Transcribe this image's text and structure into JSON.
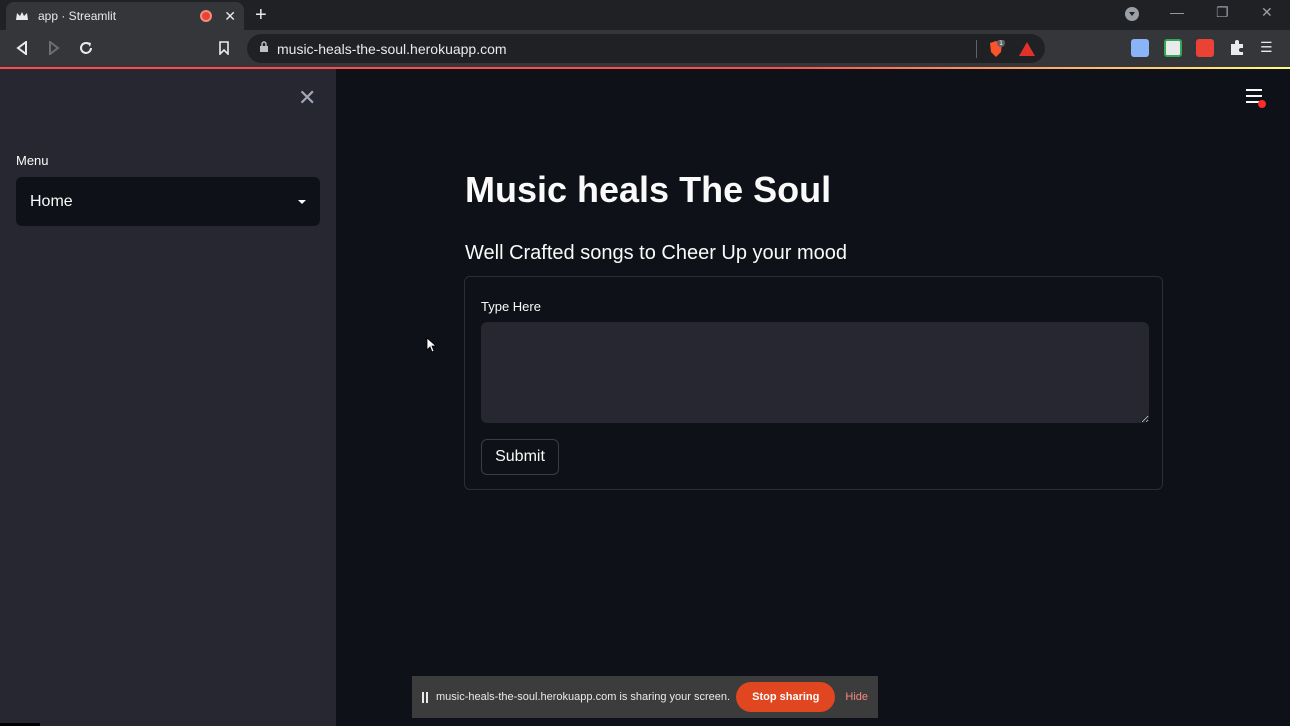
{
  "browser": {
    "tab_title": "app · Streamlit",
    "url": "music-heals-the-soul.herokuapp.com",
    "brave_badge": "1"
  },
  "sidebar": {
    "menu_label": "Menu",
    "select_value": "Home"
  },
  "main": {
    "title": "Music heals The Soul",
    "subtitle": "Well Crafted songs to Cheer Up your mood",
    "form": {
      "input_label": "Type Here",
      "input_value": "",
      "submit_label": "Submit"
    }
  },
  "share_bar": {
    "message": "music-heals-the-soul.herokuapp.com is sharing your screen.",
    "stop_label": "Stop sharing",
    "hide_label": "Hide"
  },
  "colors": {
    "accent": "#ff4b4b",
    "stop_button": "#e0461f",
    "sidebar_bg": "#262730",
    "main_bg": "#0e1117"
  }
}
